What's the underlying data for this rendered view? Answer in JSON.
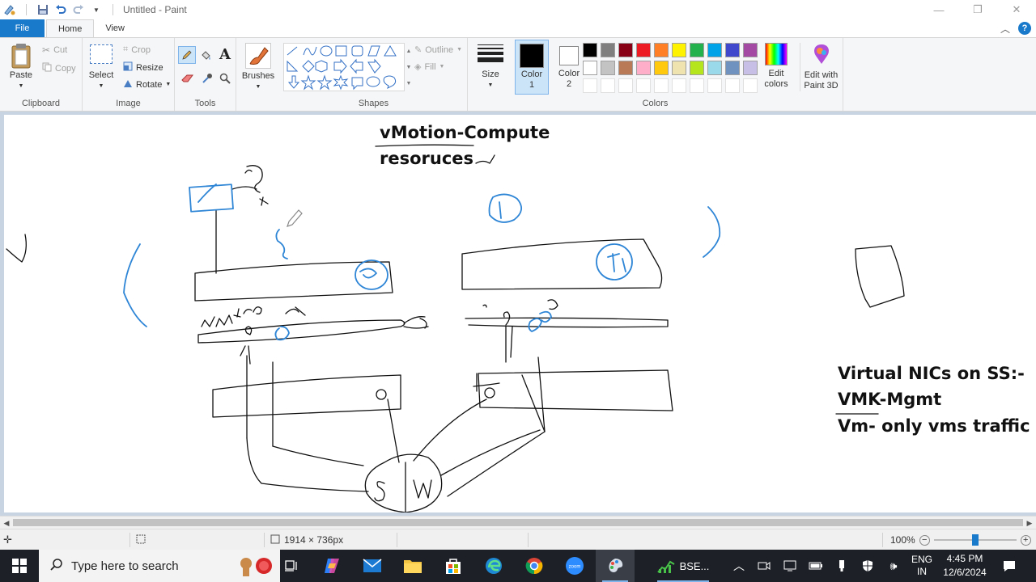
{
  "window": {
    "title": "Untitled - Paint",
    "minimize": "—",
    "restore": "❐",
    "close": "✕"
  },
  "tabs": {
    "file": "File",
    "home": "Home",
    "view": "View",
    "help": "?"
  },
  "ribbon": {
    "clipboard": {
      "label": "Clipboard",
      "paste": "Paste",
      "cut": "Cut",
      "copy": "Copy"
    },
    "image": {
      "label": "Image",
      "select": "Select",
      "crop": "Crop",
      "resize": "Resize",
      "rotate": "Rotate"
    },
    "tools": {
      "label": "Tools"
    },
    "brushes": {
      "label": "Brushes"
    },
    "shapes": {
      "label": "Shapes",
      "outline": "Outline",
      "fill": "Fill"
    },
    "size": {
      "label": "Size"
    },
    "colors": {
      "label": "Colors",
      "color1": "Color 1",
      "color1_num": "",
      "color2": "Color 2",
      "edit_colors": "Edit colors",
      "edit_3d": "Edit with Paint 3D",
      "color1_value": "#000000",
      "color2_value": "#ffffff",
      "palette_row1": [
        "#000000",
        "#7f7f7f",
        "#880015",
        "#ed1c24",
        "#ff7f27",
        "#fff200",
        "#22b14c",
        "#00a2e8",
        "#3f48cc",
        "#a349a4"
      ],
      "palette_row2": [
        "#ffffff",
        "#c3c3c3",
        "#b97a57",
        "#ffaec9",
        "#ffc90e",
        "#efe4b0",
        "#b5e61d",
        "#99d9ea",
        "#7092be",
        "#c8bfe7"
      ]
    }
  },
  "canvas": {
    "heading1": "vMotion-Compute",
    "heading2": "resoruces",
    "note1": "Virtual NICs on SS:-",
    "note2": "VMK-Mgmt",
    "note3": "Vm- only vms traffic"
  },
  "status": {
    "dimensions": "1914 × 736px",
    "zoom": "100%",
    "zoom_level": 0.5
  },
  "taskbar": {
    "search_placeholder": "Type here to search",
    "app_label": "BSE...",
    "lang1": "ENG",
    "lang2": "IN",
    "time": "4:45 PM",
    "date": "12/6/2024"
  }
}
